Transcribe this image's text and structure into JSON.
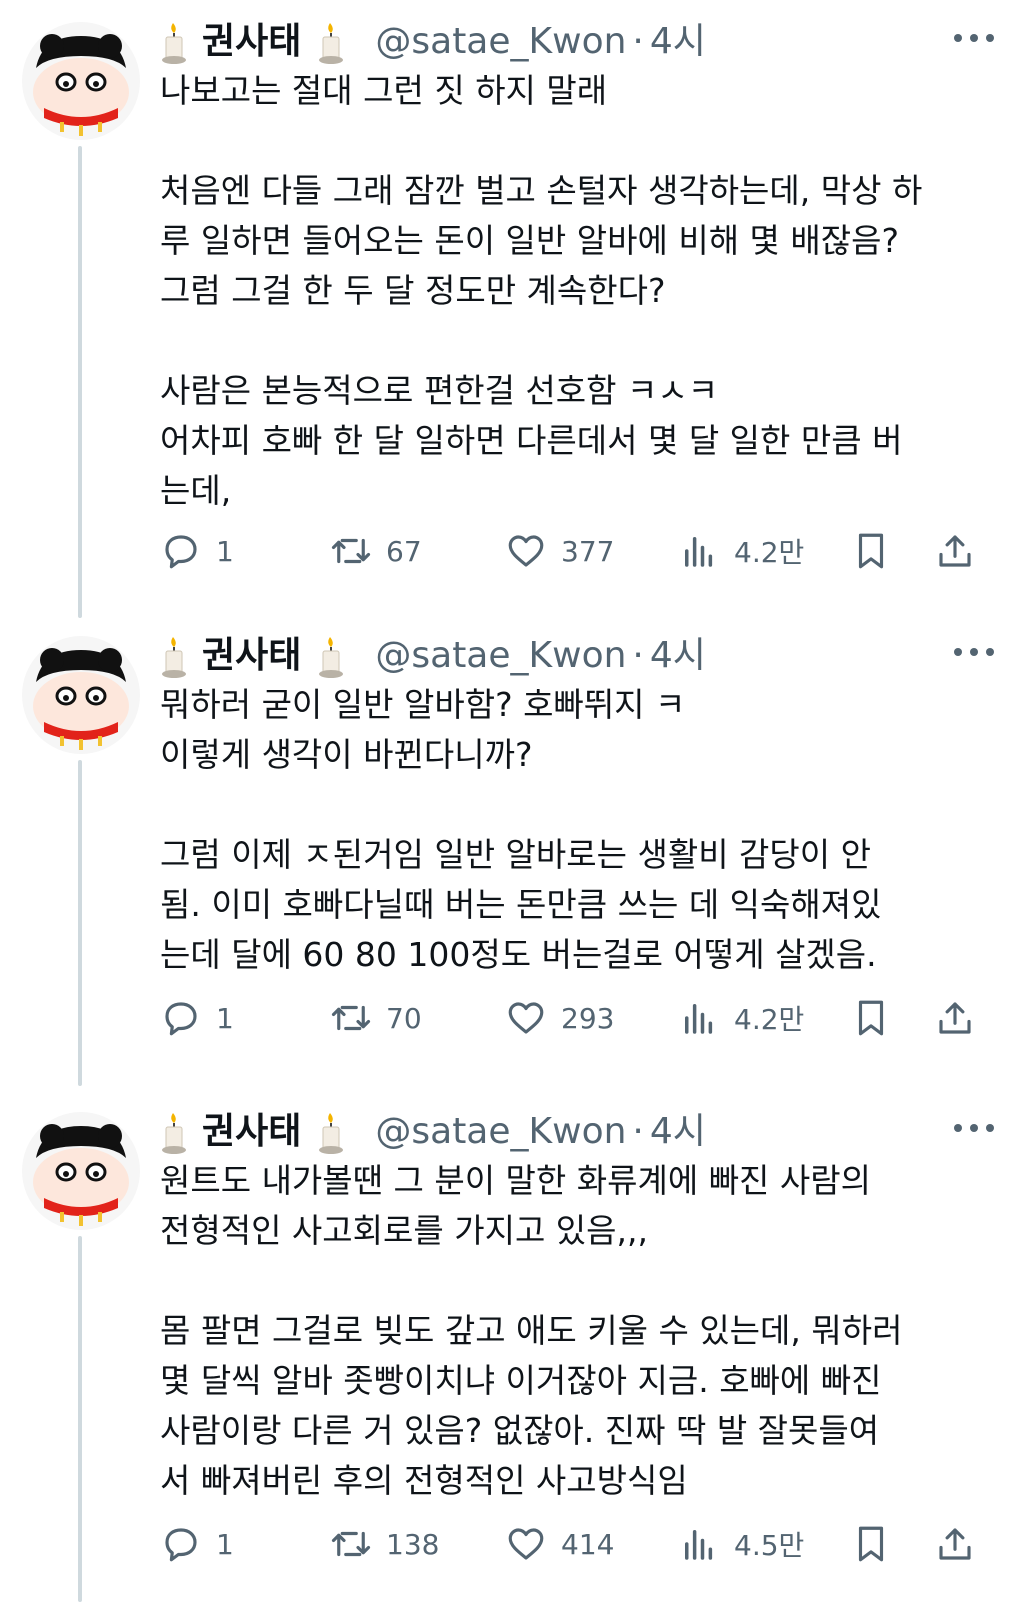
{
  "tweets": [
    {
      "author": {
        "name": "권사태",
        "handle": "@satae_Kwon",
        "dot": "·",
        "time": "4시"
      },
      "paragraphs": [
        "나보고는 절대 그런 짓 하지 말래",
        "처음엔 다들 그래 잠깐 벌고 손털자 생각하는데, 막상 하\n루 일하면 들어오는 돈이 일반 알바에 비해 몇 배잖음?\n그럼 그걸 한 두 달 정도만 계속한다?",
        "사람은 본능적으로 편한걸 선호함 ㅋㅅㅋ\n어차피 호빠 한 달 일하면 다른데서 몇 달 일한 만큼 버\n는데,"
      ],
      "stats": {
        "replies": "1",
        "retweets": "67",
        "likes": "377",
        "views": "4.2만"
      }
    },
    {
      "author": {
        "name": "권사태",
        "handle": "@satae_Kwon",
        "dot": "·",
        "time": "4시"
      },
      "paragraphs": [
        "뭐하러 굳이 일반 알바함? 호빠뛰지 ㅋ\n이렇게 생각이 바뀐다니까?",
        "그럼 이제 ㅈ된거임 일반 알바로는 생활비 감당이 안\n됨. 이미 호빠다닐때 버는 돈만큼 쓰는 데 익숙해져있\n는데 달에 60 80 100정도 버는걸로 어떻게 살겠음."
      ],
      "stats": {
        "replies": "1",
        "retweets": "70",
        "likes": "293",
        "views": "4.2만"
      }
    },
    {
      "author": {
        "name": "권사태",
        "handle": "@satae_Kwon",
        "dot": "·",
        "time": "4시"
      },
      "paragraphs": [
        "원트도 내가볼땐 그 분이 말한 화류계에 빠진 사람의\n전형적인 사고회로를 가지고 있음,,,",
        "몸 팔면 그걸로 빚도 갚고 애도 키울 수 있는데, 뭐하러\n몇 달씩 알바 좃빵이치냐 이거잖아 지금. 호빠에 빠진\n사람이랑 다른 거 있음? 없잖아. 진짜 딱 발 잘못들여\n서 빠져버린 후의 전형적인 사고방식임"
      ],
      "stats": {
        "replies": "1",
        "retweets": "138",
        "likes": "414",
        "views": "4.5만"
      }
    }
  ],
  "icons": {
    "avatar": "cartoon-avatar",
    "name_emoji": "candle-icon",
    "more": "more-horizontal-icon",
    "reply": "reply-icon",
    "retweet": "retweet-icon",
    "like": "heart-icon",
    "views": "views-bar-chart-icon",
    "bookmark": "bookmark-icon",
    "share": "share-icon"
  },
  "colors": {
    "text": "#0f1419",
    "secondary": "#536471",
    "thread_line": "#cfd9de",
    "avatar_accent": "#e2231a"
  }
}
